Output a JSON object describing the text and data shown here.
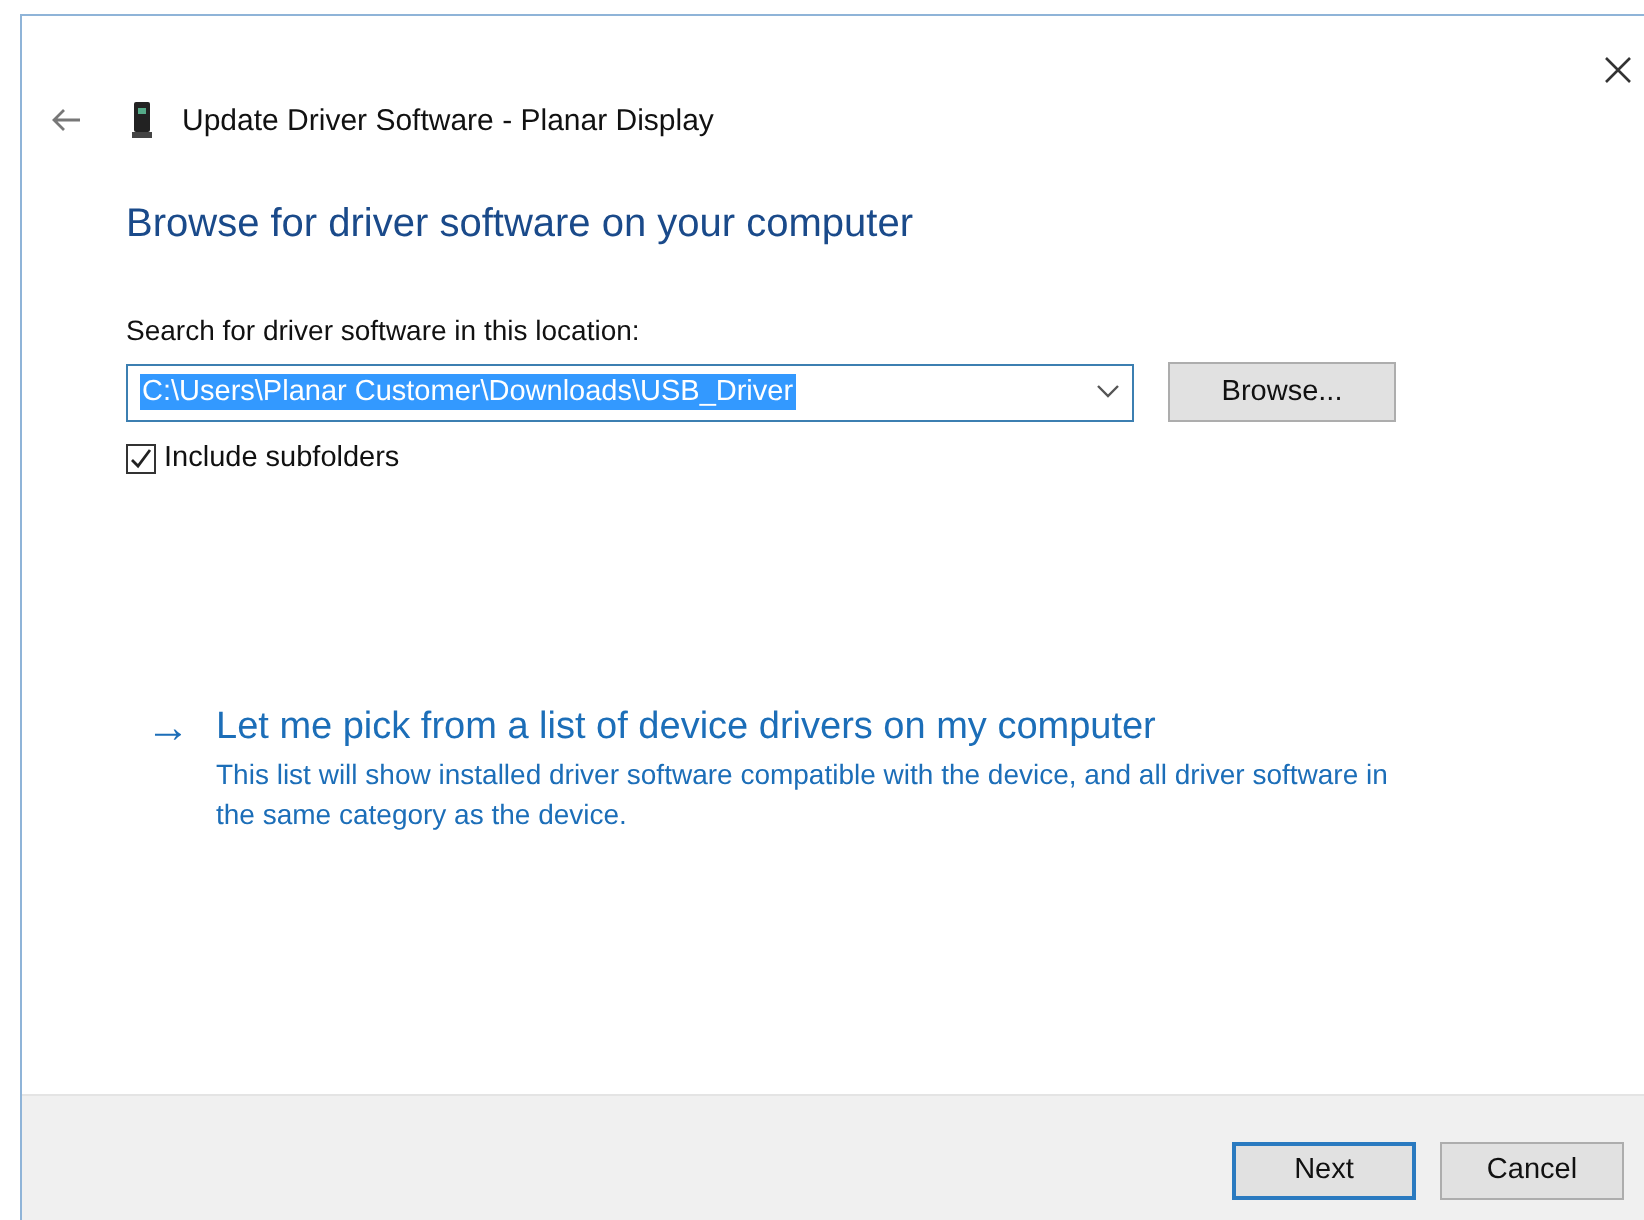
{
  "window": {
    "title": "Update Driver Software - Planar Display"
  },
  "heading": "Browse for driver software on your computer",
  "location": {
    "label": "Search for driver software in this location:",
    "value": "C:\\Users\\Planar Customer\\Downloads\\USB_Driver",
    "value_selected": true,
    "browse_button": "Browse..."
  },
  "include_subfolders": {
    "label": "Include subfolders",
    "checked": true
  },
  "pick_option": {
    "arrow": "→",
    "title": "Let me pick from a list of device drivers on my computer",
    "description": "This list will show installed driver software compatible with the device, and all driver software in the same category as the device."
  },
  "buttons": [
    {
      "label": "Next",
      "default": true
    },
    {
      "label": "Cancel",
      "default": false
    }
  ]
}
